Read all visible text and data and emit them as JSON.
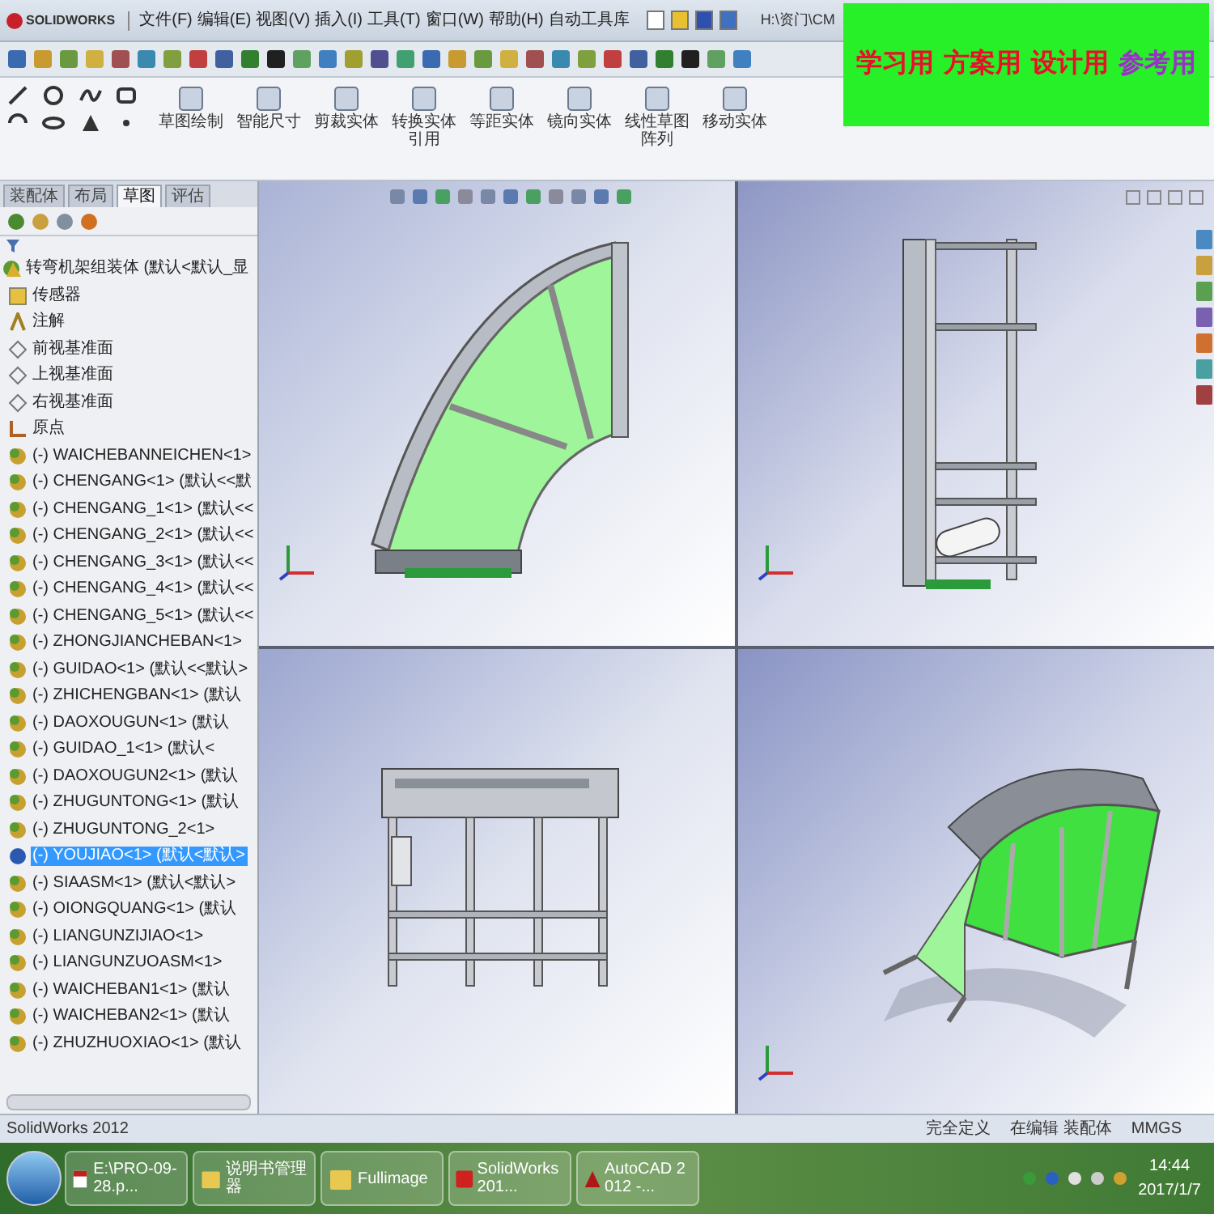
{
  "app": {
    "logo": "SOLIDWORKS",
    "menu": [
      "文件(F)",
      "编辑(E)",
      "视图(V)",
      "插入(I)",
      "工具(T)",
      "窗口(W)",
      "帮助(H)",
      "自动工具库"
    ],
    "title": "H:\\资门\\CM"
  },
  "banner": {
    "tags": [
      {
        "text": "学习用",
        "color": "#e8102a"
      },
      {
        "text": "方案用",
        "color": "#e8102a"
      },
      {
        "text": "设计用",
        "color": "#e8102a"
      },
      {
        "text": "参考用",
        "color": "#9b30c8"
      }
    ]
  },
  "commands": [
    "草图绘制",
    "智能尺寸",
    "剪裁实体",
    "转换实体引用",
    "等距实体",
    "镜向实体",
    "线性草图阵列",
    "移动实体"
  ],
  "command_tabs": [
    {
      "label": "装配体",
      "selected": false
    },
    {
      "label": "布局",
      "selected": false
    },
    {
      "label": "草图",
      "selected": true
    },
    {
      "label": "评估",
      "selected": false
    }
  ],
  "tree": {
    "root": "转弯机架组装体 (默认<默认_显",
    "items": [
      {
        "kind": "sensor",
        "label": "传感器",
        "selected": false
      },
      {
        "kind": "note",
        "label": "注解",
        "selected": false
      },
      {
        "kind": "plane",
        "label": "前视基准面",
        "selected": false
      },
      {
        "kind": "plane",
        "label": "上视基准面",
        "selected": false
      },
      {
        "kind": "plane",
        "label": "右视基准面",
        "selected": false
      },
      {
        "kind": "origin",
        "label": "原点",
        "selected": false
      },
      {
        "kind": "part",
        "label": "(-) WAICHEBANNEICHEN<1>",
        "selected": false
      },
      {
        "kind": "part",
        "label": "(-) CHENGANG<1> (默认<<默",
        "selected": false
      },
      {
        "kind": "part",
        "label": "(-) CHENGANG_1<1> (默认<<",
        "selected": false
      },
      {
        "kind": "part",
        "label": "(-) CHENGANG_2<1> (默认<<",
        "selected": false
      },
      {
        "kind": "part",
        "label": "(-) CHENGANG_3<1> (默认<<",
        "selected": false
      },
      {
        "kind": "part",
        "label": "(-) CHENGANG_4<1> (默认<<",
        "selected": false
      },
      {
        "kind": "part",
        "label": "(-) CHENGANG_5<1> (默认<<",
        "selected": false
      },
      {
        "kind": "part",
        "label": "(-) ZHONGJIANCHEBAN<1>",
        "selected": false
      },
      {
        "kind": "part",
        "label": "(-) GUIDAO<1> (默认<<默认>",
        "selected": false
      },
      {
        "kind": "part",
        "label": "(-) ZHICHENGBAN<1> (默认",
        "selected": false
      },
      {
        "kind": "part",
        "label": "(-) DAOXOUGUN<1> (默认",
        "selected": false
      },
      {
        "kind": "part",
        "label": "(-) GUIDAO_1<1> (默认<",
        "selected": false
      },
      {
        "kind": "part",
        "label": "(-) DAOXOUGUN2<1> (默认",
        "selected": false
      },
      {
        "kind": "part",
        "label": "(-) ZHUGUNTONG<1> (默认",
        "selected": false
      },
      {
        "kind": "part",
        "label": "(-) ZHUGUNTONG_2<1>",
        "selected": false
      },
      {
        "kind": "part",
        "label": "(-) YOUJIAO<1> (默认<默认>",
        "selected": true
      },
      {
        "kind": "part",
        "label": "(-) SIAASM<1> (默认<默认>",
        "selected": false
      },
      {
        "kind": "part",
        "label": "(-) OIONGQUANG<1> (默认",
        "selected": false
      },
      {
        "kind": "part",
        "label": "(-) LIANGUNZIJIAO<1>",
        "selected": false
      },
      {
        "kind": "part",
        "label": "(-) LIANGUNZUOASM<1>",
        "selected": false
      },
      {
        "kind": "part",
        "label": "(-) WAICHEBAN1<1> (默认",
        "selected": false
      },
      {
        "kind": "part",
        "label": "(-) WAICHEBAN2<1> (默认",
        "selected": false
      },
      {
        "kind": "part",
        "label": "(-) ZHUZHUOXIAO<1> (默认",
        "selected": false
      }
    ]
  },
  "status_bar": {
    "app": "SolidWorks 2012",
    "items": [
      "完全定义",
      "在编辑 装配体",
      "MMGS"
    ]
  },
  "taskbar": {
    "items": [
      {
        "kind": "pdf",
        "label": "E:\\PRO-09-28.p..."
      },
      {
        "kind": "folder",
        "label": "说明书管理器"
      },
      {
        "kind": "folder",
        "label": "Fullimage"
      },
      {
        "kind": "solidworks",
        "label": "SolidWorks 201..."
      },
      {
        "kind": "autocad",
        "label": "AutoCAD 2012 -..."
      }
    ],
    "time": "14:44",
    "date": "2017/1/7"
  }
}
